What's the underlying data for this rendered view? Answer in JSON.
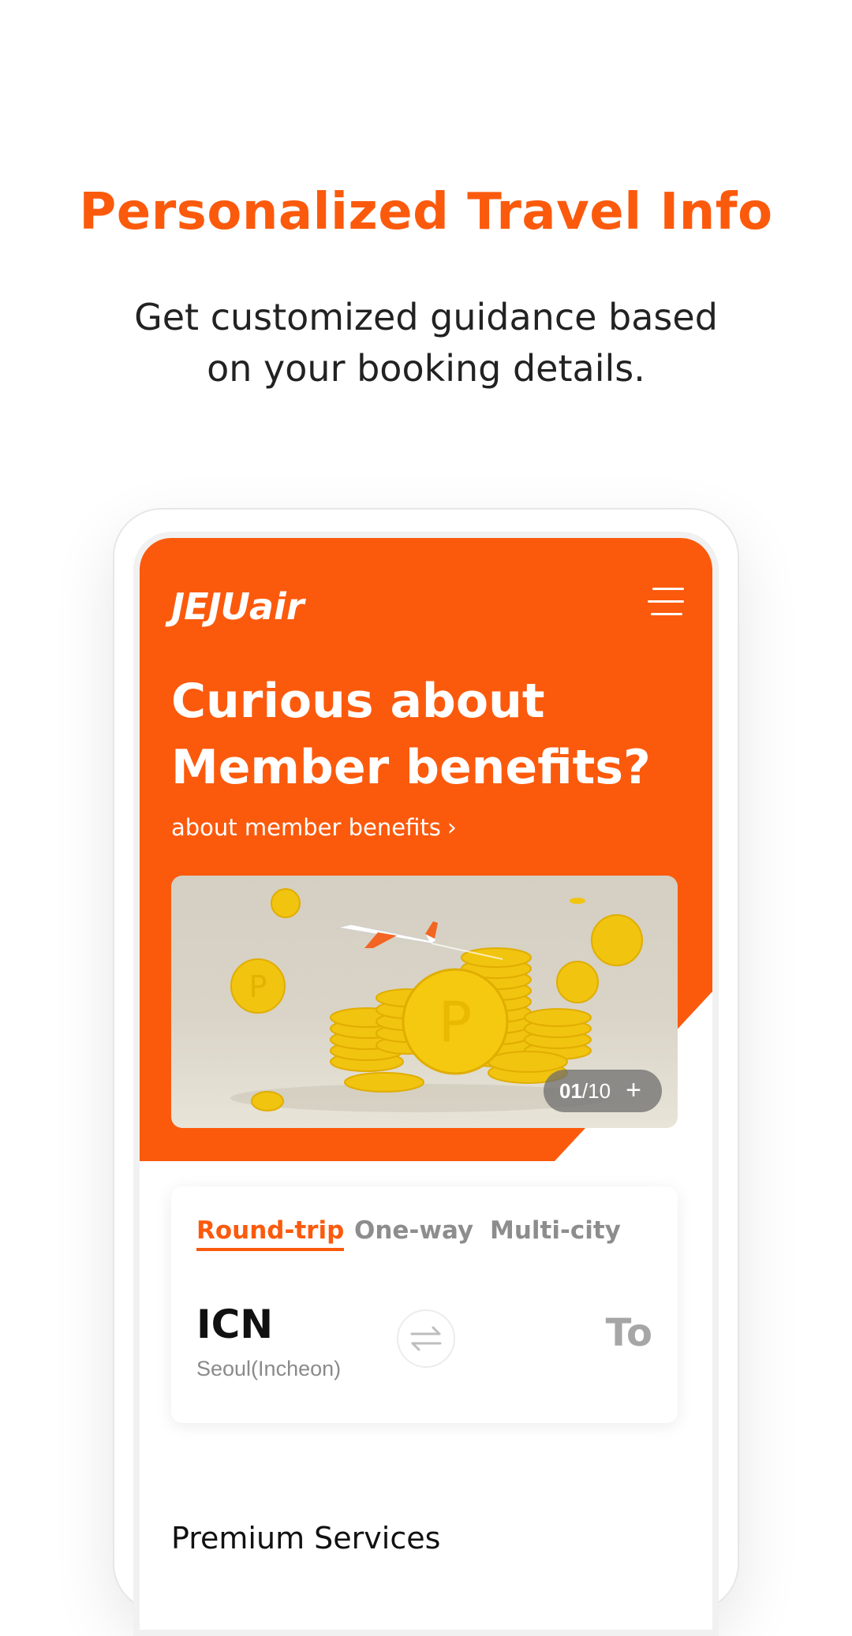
{
  "promo": {
    "title": "Personalized Travel Info",
    "subtitle_line1": "Get customized guidance based",
    "subtitle_line2": "on your booking details."
  },
  "app": {
    "logo_text": "JEJU",
    "logo_suffix": "air",
    "menu_icon": "hamburger-menu-icon",
    "brand_color": "#fb5a0d"
  },
  "hero": {
    "heading_line1": "Curious about",
    "heading_line2": "Member benefits?",
    "link_label": "about member benefits",
    "banner": {
      "current": "01",
      "total": "/10",
      "plus_label": "+"
    }
  },
  "booking": {
    "tabs": [
      {
        "label": "Round-trip",
        "active": true
      },
      {
        "label": "One-way",
        "active": false
      },
      {
        "label": "Multi-city",
        "active": false
      }
    ],
    "from_code": "ICN",
    "from_city": "Seoul(Incheon)",
    "to_label": "To"
  },
  "sections": {
    "premium_title": "Premium Services"
  }
}
